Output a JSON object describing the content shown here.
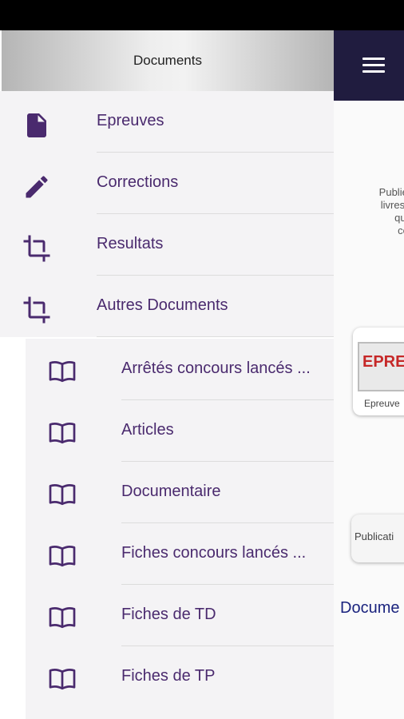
{
  "drawer": {
    "header_title": "Documents",
    "items": [
      {
        "label": "Epreuves",
        "icon": "file-icon"
      },
      {
        "label": "Corrections",
        "icon": "pencil-icon"
      },
      {
        "label": "Resultats",
        "icon": "crop-icon"
      },
      {
        "label": "Autres Documents",
        "icon": "crop-icon"
      }
    ],
    "sub_items": [
      {
        "label": "Arrêtés concours lancés ...",
        "icon": "book-icon"
      },
      {
        "label": "Articles",
        "icon": "book-icon"
      },
      {
        "label": "Documentaire",
        "icon": "book-icon"
      },
      {
        "label": "Fiches concours lancés ...",
        "icon": "book-icon"
      },
      {
        "label": "Fiches de TD",
        "icon": "book-icon"
      },
      {
        "label": "Fiches de TP",
        "icon": "book-icon"
      }
    ]
  },
  "background": {
    "intro_lines": [
      "Publiez",
      "livres,s",
      "que",
      "co"
    ],
    "card_sign": "EPREU",
    "card_caption": "Epreuve",
    "pub_card": "Publicati",
    "doc_link": "Docume"
  },
  "colors": {
    "accent": "#4a2a6e",
    "app_bar": "#201c3f",
    "drawer_item_bg": "#f4f3f5",
    "link": "#1a237e"
  }
}
